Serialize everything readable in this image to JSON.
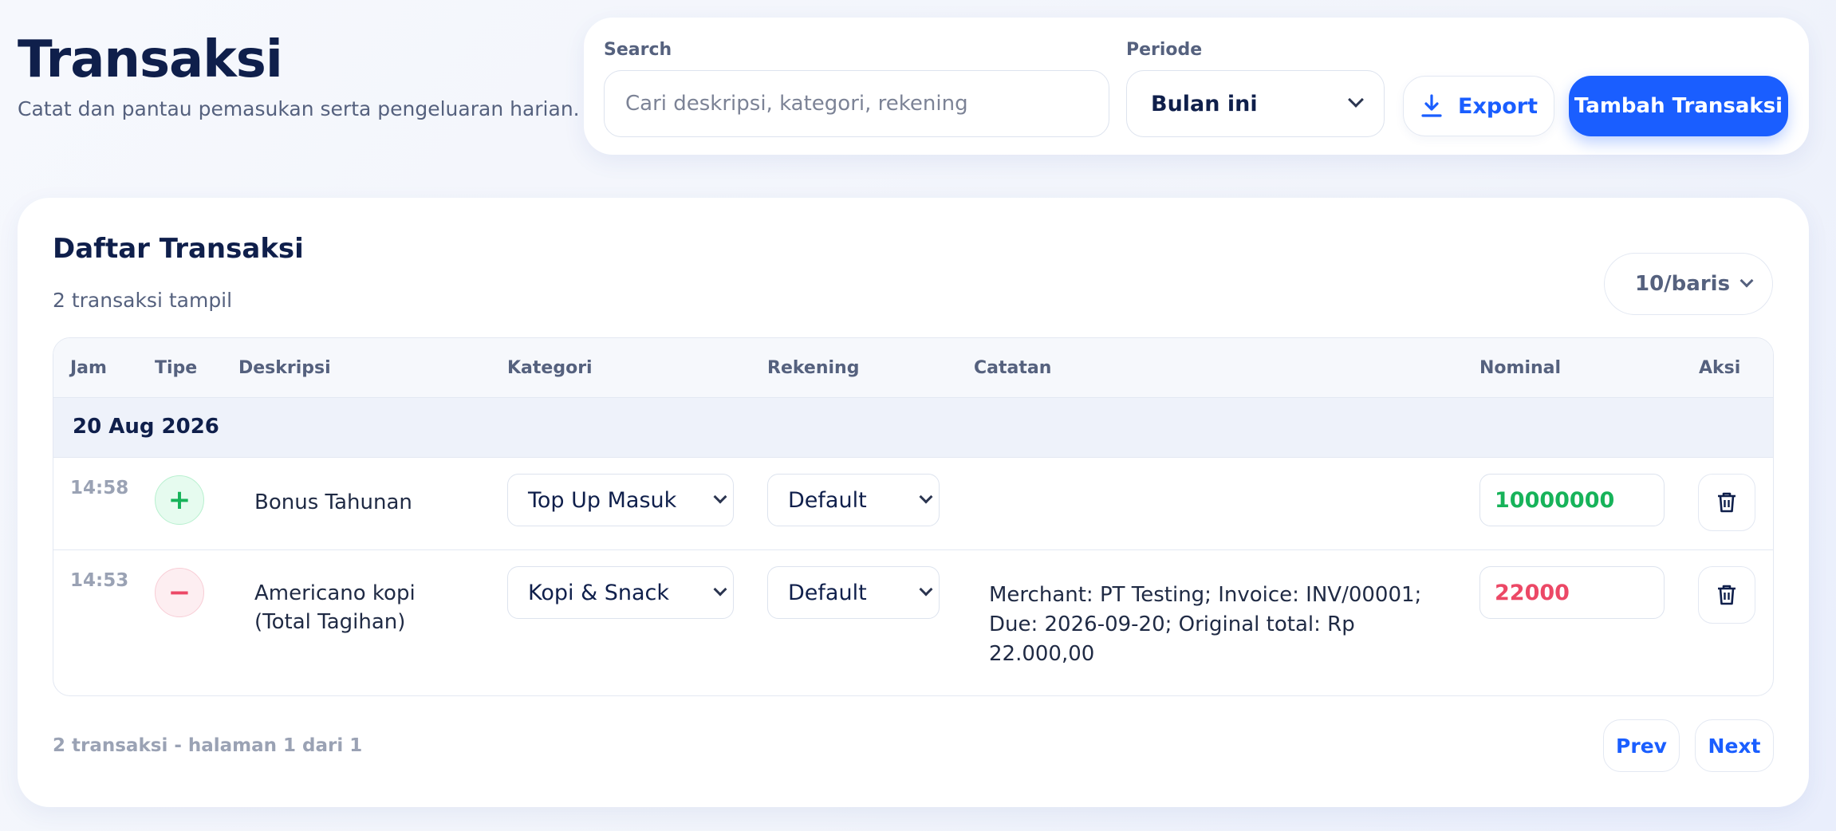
{
  "page": {
    "title": "Transaksi",
    "subtitle": "Catat dan pantau pemasukan serta pengeluaran harian."
  },
  "toolbar": {
    "search_label": "Search",
    "search_placeholder": "Cari deskripsi, kategori, rekening",
    "search_value": "",
    "period_label": "Periode",
    "period_value": "Bulan ini",
    "export_label": "Export",
    "add_label": "Tambah Transaksi"
  },
  "list": {
    "title": "Daftar Transaksi",
    "count_text": "2 transaksi tampil",
    "per_page": "10/baris",
    "columns": [
      "Jam",
      "Tipe",
      "Deskripsi",
      "Kategori",
      "Rekening",
      "Catatan",
      "Nominal",
      "Aksi"
    ],
    "group_date": "20 Aug 2026",
    "rows": [
      {
        "time": "14:58",
        "type": "+",
        "type_kind": "income",
        "description": "Bonus Tahunan",
        "category": "Top Up Masuk",
        "account": "Default",
        "note": "",
        "amount": "10000000"
      },
      {
        "time": "14:53",
        "type": "−",
        "type_kind": "expense",
        "description": "Americano kopi (Total Tagihan)",
        "category": "Kopi & Snack",
        "account": "Default",
        "note": "Merchant: PT Testing; Invoice: INV/00001; Due: 2026-09-20; Original total: Rp 22.000,00",
        "amount": "22000"
      }
    ],
    "footer_text": "2 transaksi - halaman 1 dari 1",
    "prev_label": "Prev",
    "next_label": "Next"
  },
  "colors": {
    "primary": "#1a5eff",
    "income": "#17b35a",
    "expense": "#ec4866",
    "heading": "#0f1f4b"
  },
  "icons": {
    "export": "download-icon",
    "delete": "trash-icon",
    "dropdown": "chevron-down-icon"
  }
}
